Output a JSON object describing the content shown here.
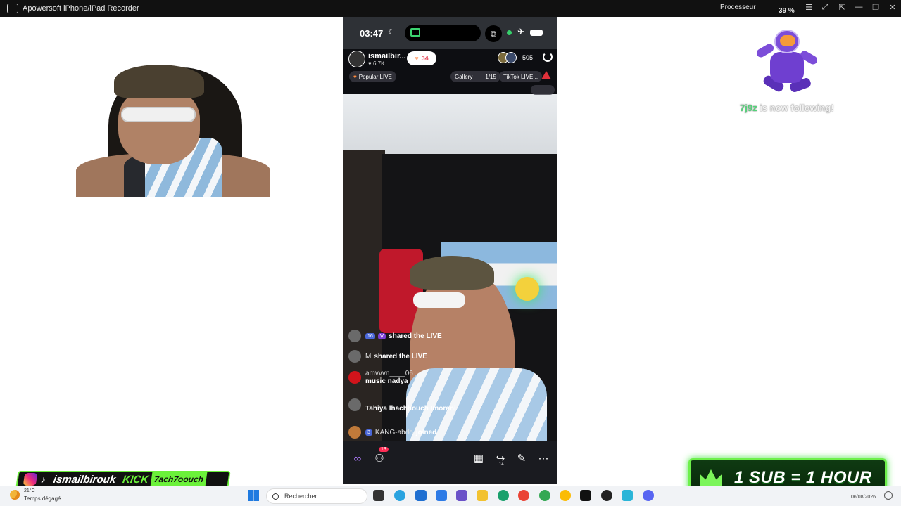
{
  "window": {
    "title": "Apowersoft iPhone/iPad Recorder",
    "cpu_label": "Processeur",
    "cpu_value": "39 %"
  },
  "phone": {
    "status": {
      "time": "03:47"
    },
    "host": {
      "name": "ismailbir...",
      "likes": "6.7K",
      "gift_count": "34"
    },
    "viewers": {
      "count": "505"
    },
    "pills": {
      "popular": "Popular LIVE",
      "gallery": "Gallery",
      "gallery_count": "1/15",
      "tiktok": "TikTok LIVE..."
    },
    "chat": [
      {
        "level": "16",
        "badge": "V",
        "user": "",
        "message": "shared the LIVE"
      },
      {
        "user": "M",
        "message": "shared the LIVE"
      },
      {
        "user": "amvvvn____06",
        "message": "music nadya"
      },
      {
        "user": "",
        "message": "Tahiya lhachhouch Imorani"
      },
      {
        "level": "3",
        "user": "KANG-abdo",
        "message": "joined"
      }
    ],
    "toolbar": {
      "badge_count": "13",
      "rank_count": "14"
    }
  },
  "overlay": {
    "follow": {
      "user": "7j9z",
      "text": " is now following!"
    },
    "social": {
      "handle": "ismailbirouk",
      "kick_label": "KICK",
      "kick_handle": "7ach7oouch"
    },
    "sub_banner": "1 SUB = 1 HOUR"
  },
  "taskbar": {
    "weather_temp": "21°C",
    "weather_desc": "Temps dégagé",
    "search_placeholder": "Rechercher",
    "date": "06/08/2026"
  },
  "colors": {
    "accent_green": "#6df04a",
    "follow_user": "#55d37a",
    "gift_red": "#e6495b",
    "level_blue": "#4a67d8"
  },
  "icons": [
    "app-icon",
    "moon-icon",
    "airplay-icon",
    "airplane-icon",
    "battery-icon",
    "heart-icon",
    "power-icon",
    "warning-icon",
    "camera-icon",
    "infinity-icon",
    "users-icon",
    "film-icon",
    "share-icon",
    "magic-wand-icon",
    "more-icon",
    "instagram-icon",
    "tiktok-icon",
    "crown-icon",
    "windows-start-icon",
    "search-icon"
  ]
}
